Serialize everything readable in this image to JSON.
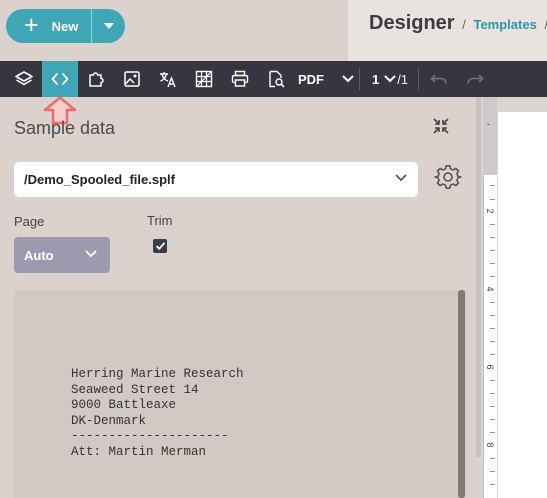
{
  "header": {
    "new_label": "New",
    "plus_glyph": "+",
    "breadcrumb_title": "Designer",
    "breadcrumb_sep": "/",
    "breadcrumb_link": "Templates",
    "breadcrumb_sep2": "/"
  },
  "toolbar": {
    "items": [
      {
        "icon": "layers-icon"
      },
      {
        "icon": "code-icon",
        "active": true
      },
      {
        "icon": "puzzle-icon"
      },
      {
        "icon": "image-icon"
      },
      {
        "icon": "translate-icon"
      },
      {
        "icon": "grid-icon"
      },
      {
        "icon": "print-icon"
      },
      {
        "icon": "preview-icon"
      }
    ],
    "format_label": "PDF",
    "page_current": "1",
    "page_total": "/1"
  },
  "sample_data": {
    "title": "Sample data",
    "file_value": "/Demo_Spooled_file.splf",
    "page_label": "Page",
    "page_value": "Auto",
    "trim_label": "Trim",
    "trim_checked": true,
    "preview_lines": "Herring Marine Research\nSeaweed Street 14\n9000 Battleaxe\nDK-Denmark\n---------------------\nAtt: Martin Merman"
  },
  "ruler": {
    "top_mark": "-",
    "numbers": [
      "2",
      "4",
      "6",
      "8"
    ]
  },
  "colors": {
    "accent": "#3fa6b5",
    "toolbar": "#363640",
    "panel_bg": "#dbd2cd",
    "arrow": "#f26a6a"
  }
}
